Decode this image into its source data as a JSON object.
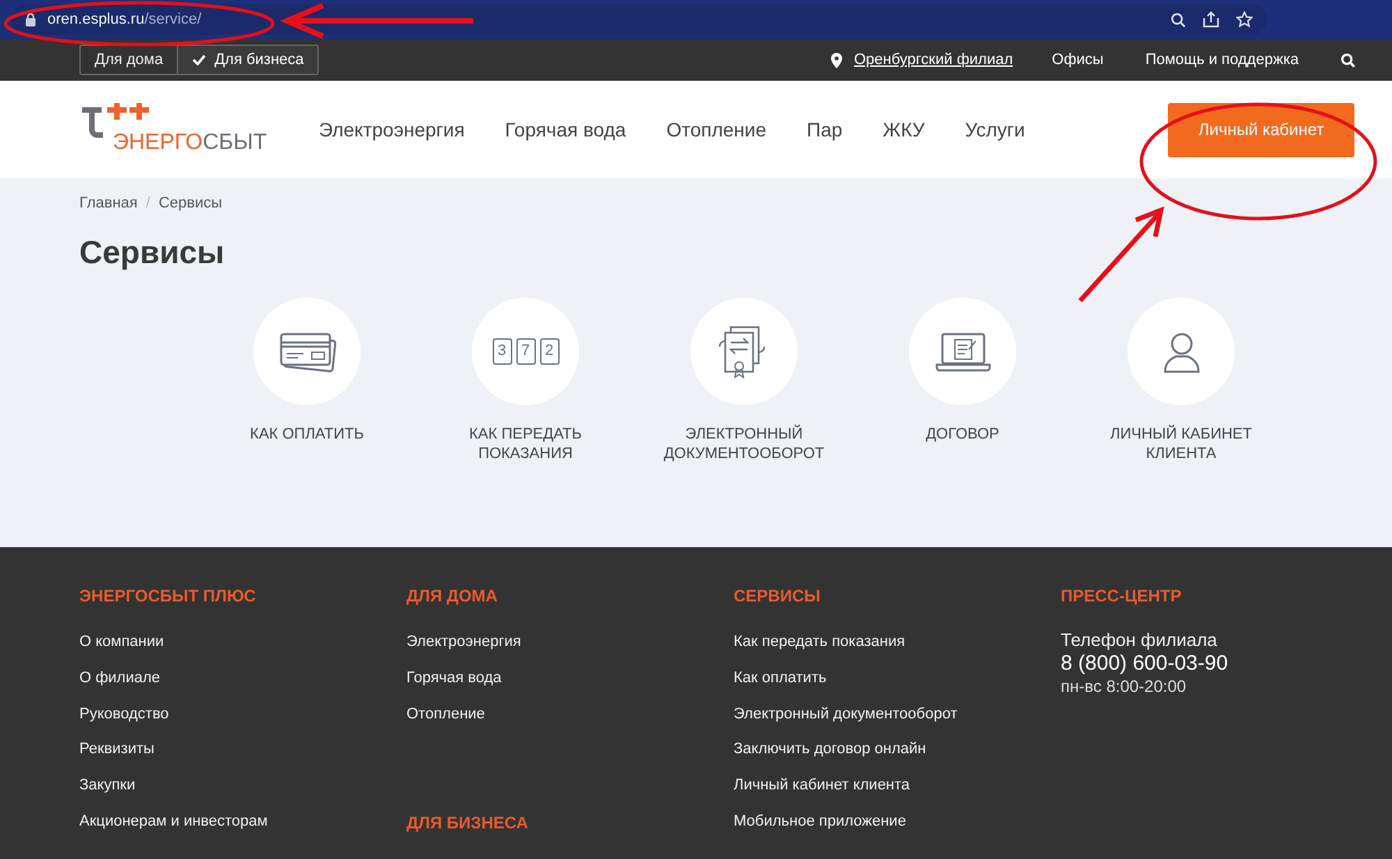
{
  "browser": {
    "url_host": "oren.esplus.ru",
    "url_path": "/service/"
  },
  "topbar": {
    "segments": [
      {
        "label": "Для дома",
        "selected": false
      },
      {
        "label": "Для бизнеса",
        "selected": true
      }
    ],
    "branch": "Оренбургский филиал",
    "links": [
      "Офисы",
      "Помощь и поддержка"
    ]
  },
  "header": {
    "logo": {
      "accent": "ЭНЕРГО",
      "rest": "СБЫТ"
    },
    "nav": [
      "Электроэнергия",
      "Горячая вода",
      "Отопление",
      "Пар",
      "ЖКУ",
      "Услуги"
    ],
    "cabinet_button": "Личный кабинет"
  },
  "breadcrumbs": [
    "Главная",
    "Сервисы"
  ],
  "breadcrumb_separator": "/",
  "page_title": "Сервисы",
  "services": [
    {
      "kind": "card",
      "label": "КАК ОПЛАТИТЬ"
    },
    {
      "kind": "meter",
      "label": "КАК ПЕРЕДАТЬ ПОКАЗАНИЯ",
      "digits": [
        "3",
        "7",
        "2"
      ]
    },
    {
      "kind": "document",
      "label": "ЭЛЕКТРОННЫЙ ДОКУМЕНТООБОРОТ"
    },
    {
      "kind": "laptop",
      "label": "ДОГОВОР"
    },
    {
      "kind": "person",
      "label": "ЛИЧНЫЙ КАБИНЕТ КЛИЕНТА"
    }
  ],
  "footer": {
    "columns": [
      {
        "sections": [
          {
            "title": "ЭНЕРГОСБЫТ ПЛЮС",
            "links": [
              "О компании",
              "О филиале",
              "Руководство",
              "Реквизиты",
              "Закупки",
              "Акционерам и инвесторам"
            ]
          }
        ]
      },
      {
        "sections": [
          {
            "title": "ДЛЯ ДОМА",
            "links": [
              "Электроэнергия",
              "Горячая вода",
              "Отопление"
            ]
          },
          {
            "title": "ДЛЯ БИЗНЕСА"
          }
        ]
      },
      {
        "sections": [
          {
            "title": "СЕРВИСЫ",
            "links": [
              "Как передать показания",
              "Как оплатить",
              "Электронный документооборот",
              "Заключить договор онлайн",
              "Личный кабинет клиента",
              "Мобильное приложение"
            ]
          }
        ]
      }
    ],
    "press": {
      "title": "ПРЕСС-ЦЕНТР",
      "phone_label": "Телефон филиала",
      "phone": "8 (800) 600-03-90",
      "hours": "пн-вс 8:00-20:00"
    }
  }
}
